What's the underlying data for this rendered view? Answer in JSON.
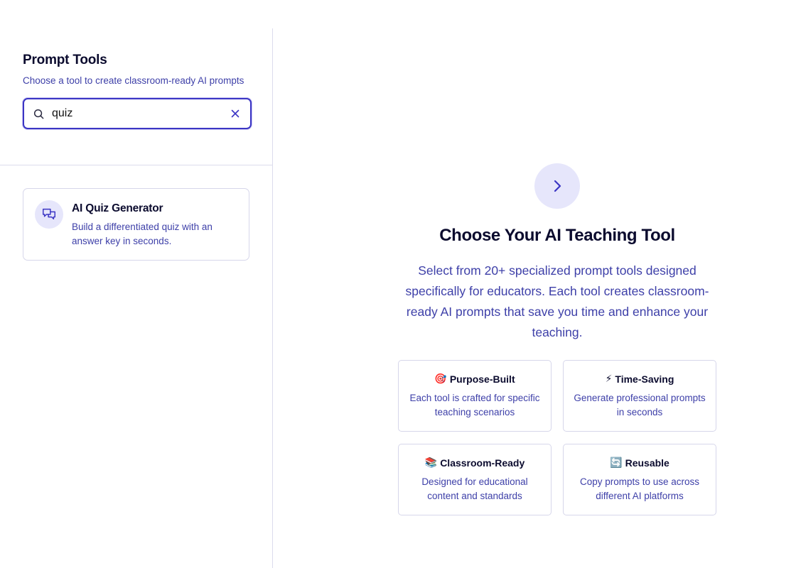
{
  "sidebar": {
    "title": "Prompt Tools",
    "subtitle": "Choose a tool to create classroom-ready AI prompts",
    "search": {
      "value": "quiz",
      "icon": "search-icon",
      "clear_icon": "close-icon"
    },
    "results": [
      {
        "title": "AI Quiz Generator",
        "description": "Build a differentiated quiz with an answer key in seconds.",
        "icon": "chat-bubbles-icon"
      }
    ]
  },
  "main": {
    "icon": "chevron-right-icon",
    "title": "Choose Your AI Teaching Tool",
    "description": "Select from 20+ specialized prompt tools designed specifically for educators. Each tool creates classroom-ready AI prompts that save you time and enhance your teaching.",
    "features": [
      {
        "emoji": "🎯",
        "title": "Purpose-Built",
        "description": "Each tool is crafted for specific teaching scenarios"
      },
      {
        "emoji": "⚡",
        "title": "Time-Saving",
        "description": "Generate professional prompts in seconds"
      },
      {
        "emoji": "📚",
        "title": "Classroom-Ready",
        "description": "Designed for educational content and standards"
      },
      {
        "emoji": "🔄",
        "title": "Reusable",
        "description": "Copy prompts to use across different AI platforms"
      }
    ]
  },
  "colors": {
    "accent": "#3b35c4",
    "text_primary": "#0b0b2e",
    "text_secondary": "#3d3fa8",
    "icon_bg": "#e6e6fb",
    "border": "#d6d6ea"
  }
}
